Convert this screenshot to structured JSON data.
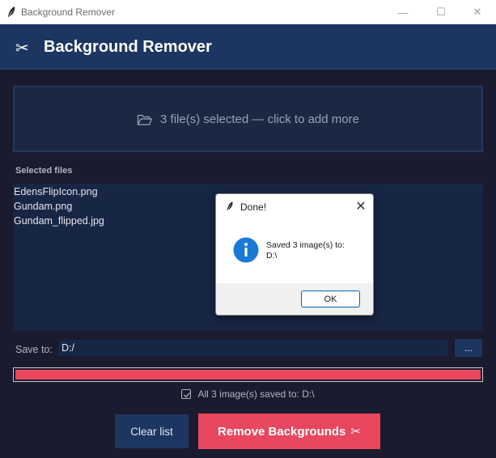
{
  "window": {
    "title": "Background Remover",
    "minimize_glyph": "—",
    "maximize_glyph": "☐",
    "close_glyph": "✕"
  },
  "header": {
    "icon": "✂",
    "title": "Background Remover"
  },
  "dropzone": {
    "icon": "folder-open-icon",
    "text": "3 file(s) selected — click to add more"
  },
  "files": {
    "label": "Selected files",
    "items": [
      "EdensFlipIcon.png",
      "Gundam.png",
      "Gundam_flipped.jpg"
    ]
  },
  "save": {
    "label": "Save to:",
    "value": "D:/",
    "browse_label": "..."
  },
  "progress": {
    "value_percent": 100,
    "color": "#e8475f"
  },
  "status": {
    "checked": true,
    "text": "All 3 image(s) saved to: D:\\"
  },
  "actions": {
    "clear_label": "Clear list",
    "remove_label": "Remove Backgrounds",
    "remove_icon": "✂"
  },
  "dialog": {
    "title": "Done!",
    "close_glyph": "✕",
    "message_line1": "Saved 3 image(s) to:",
    "message_line2": "D:\\",
    "ok_label": "OK"
  },
  "colors": {
    "background": "#1a1b2e",
    "header": "#1c3661",
    "accent": "#e8475f",
    "panel": "#182645",
    "info_blue": "#1b79d6"
  }
}
